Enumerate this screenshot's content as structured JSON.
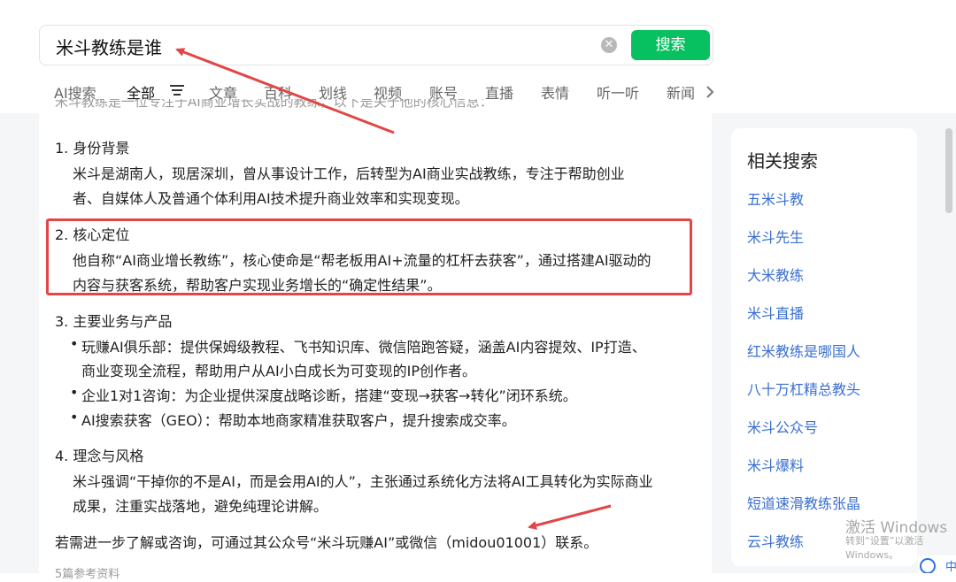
{
  "search": {
    "query": "米斗教练是谁",
    "clear_symbol": "✕",
    "button_label": "搜索"
  },
  "tabs": [
    "AI搜索",
    "全部",
    "文章",
    "百科",
    "划线",
    "视频",
    "账号",
    "直播",
    "表情",
    "听一听",
    "新闻"
  ],
  "cut_line": "米斗教练是一位专注于AI商业增长实战的教练，以下是关于他的核心信息：",
  "sections": {
    "s1_title": "1. 身份背景",
    "s1_l1": "米斗是湖南人，现居深圳，曾从事设计工作，后转型为AI商业实战教练，专注于帮助创业",
    "s1_l2": "者、自媒体人及普通个体利用AI技术提升商业效率和实现变现。",
    "s2_title": "2. 核心定位",
    "s2_l1": "他自称“AI商业增长教练”，核心使命是“帮老板用AI+流量的杠杆去获客”，通过搭建AI驱动的",
    "s2_l2": "内容与获客系统，帮助客户实现业务增长的“确定性结果”。",
    "s3_title": "3. 主要业务与产品",
    "s3_b1_l1": "玩赚AI俱乐部：提供保姆级教程、飞书知识库、微信陪跑答疑，涵盖AI内容提效、IP打造、",
    "s3_b1_l2": "商业变现全流程，帮助用户从AI小白成长为可变现的IP创作者。",
    "s3_b2": "企业1对1咨询：为企业提供深度战略诊断，搭建“变现→获客→转化”闭环系统。",
    "s3_b3": "AI搜索获客（GEO）：帮助本地商家精准获取客户，提升搜索成交率。",
    "s4_title": "4. 理念与风格",
    "s4_l1": "米斗强调“干掉你的不是AI，而是会用AI的人”，主张通过系统化方法将AI工具转化为实际商业",
    "s4_l2": "成果，注重实战落地，避免纯理论讲解。",
    "contact": "若需进一步了解或咨询，可通过其公众号“米斗玩赚AI”或微信（midou01001）联系。"
  },
  "bottom": {
    "refs": "5篇参考资料"
  },
  "related": {
    "title": "相关搜索",
    "items": [
      "五米斗教",
      "米斗先生",
      "大米教练",
      "米斗直播",
      "红米教练是哪国人",
      "八十万杠精总教头",
      "米斗公众号",
      "米斗爆料",
      "短道速滑教练张晶",
      "云斗教练"
    ]
  },
  "watermark": {
    "line1": "激活 Windows",
    "line2": "转到“设置”以激活 Windows。"
  },
  "tray": {
    "label": "中"
  },
  "colors": {
    "accent_green": "#07c160",
    "link_blue": "#3a6fd0",
    "annotation_red": "#e24646"
  }
}
